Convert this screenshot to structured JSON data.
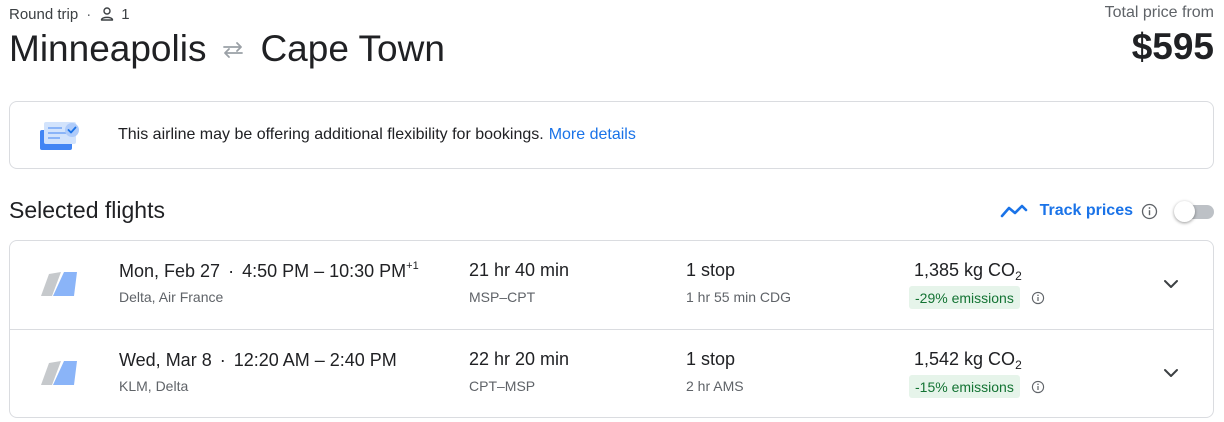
{
  "header": {
    "trip_type": "Round trip",
    "separator": "·",
    "passenger_icon": "person-icon",
    "passengers": "1",
    "origin": "Minneapolis",
    "swap_icon": "swap-arrows-icon",
    "destination": "Cape Town",
    "price_label": "Total price from",
    "price": "$595"
  },
  "notice": {
    "icon": "flexible-booking-icon",
    "text": "This airline may be offering additional flexibility for bookings.",
    "link": "More details"
  },
  "selected": {
    "title": "Selected flights",
    "track_icon": "trend-line-icon",
    "track_label": "Track prices",
    "info_icon": "info-icon",
    "track_enabled": false
  },
  "flights": [
    {
      "date": "Mon, Feb 27",
      "separator": "·",
      "time_range": "4:50 PM – 10:30 PM",
      "day_offset": "+1",
      "carriers": "Delta, Air France",
      "duration": "21 hr 40 min",
      "airports": "MSP–CPT",
      "stops": "1 stop",
      "layover": "1 hr 55 min CDG",
      "co2_amount": "1,385 kg CO",
      "co2_sub": "2",
      "emissions_badge": "-29% emissions"
    },
    {
      "date": "Wed, Mar 8",
      "separator": "·",
      "time_range": "12:20 AM – 2:40 PM",
      "day_offset": "",
      "carriers": "KLM, Delta",
      "duration": "22 hr 20 min",
      "airports": "CPT–MSP",
      "stops": "1 stop",
      "layover": "2 hr AMS",
      "co2_amount": "1,542 kg CO",
      "co2_sub": "2",
      "emissions_badge": "-15% emissions"
    }
  ],
  "colors": {
    "accent": "#1a73e8",
    "text": "#202124",
    "secondary_text": "#5f6368",
    "border": "#dadce0",
    "badge_bg": "#e6f4ea",
    "badge_text": "#137333"
  }
}
